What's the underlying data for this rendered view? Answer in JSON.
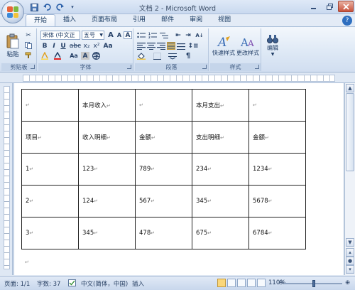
{
  "window": {
    "title": "文档 2 - Microsoft Word",
    "controls": [
      "minimize-icon",
      "restore-icon",
      "close-icon"
    ]
  },
  "quick_access": [
    "save-icon",
    "undo-icon",
    "redo-icon",
    "customize-icon"
  ],
  "tabs": [
    {
      "label": "开始",
      "active": true
    },
    {
      "label": "插入"
    },
    {
      "label": "页面布局"
    },
    {
      "label": "引用"
    },
    {
      "label": "邮件"
    },
    {
      "label": "审阅"
    },
    {
      "label": "视图"
    }
  ],
  "ribbon": {
    "clipboard": {
      "paste_label": "粘贴",
      "group_label": "剪贴板"
    },
    "font": {
      "font_name": "宋体 (中文正",
      "font_size": "五号",
      "group_label": "字体"
    },
    "paragraph": {
      "group_label": "段落"
    },
    "styles": {
      "quick_styles_label": "快速样式",
      "change_styles_label": "更改样式",
      "group_label": "样式"
    },
    "editing": {
      "label": "编辑"
    }
  },
  "document": {
    "table": [
      [
        "",
        "本月收入",
        "",
        "本月支出",
        ""
      ],
      [
        "项目",
        "收入明细",
        "金额",
        "支出明细",
        "金额"
      ],
      [
        "1",
        "123",
        "789",
        "234",
        "1234"
      ],
      [
        "2",
        "124",
        "567",
        "345",
        "5678"
      ],
      [
        "3",
        "345",
        "478",
        "675",
        "6784"
      ]
    ]
  },
  "status": {
    "page": "页面: 1/1",
    "words": "字数: 37",
    "language": "中文(简体，中国)",
    "mode": "插入",
    "zoom": "110%"
  },
  "colors": {
    "ribbon_bg": "#dde8f5",
    "tab_text": "#15375f",
    "accent": "#2e6fc0"
  }
}
